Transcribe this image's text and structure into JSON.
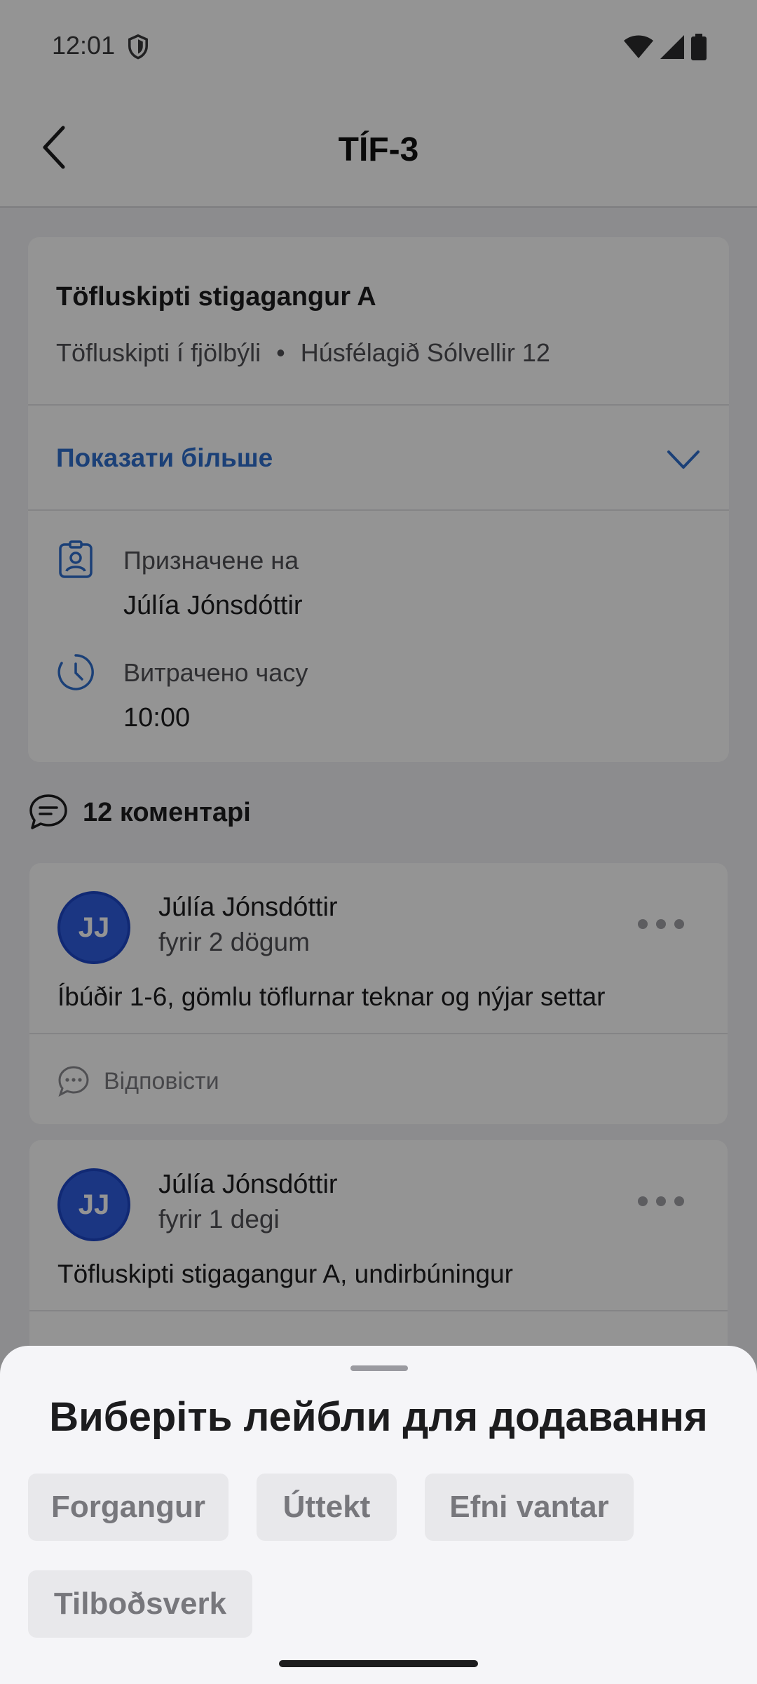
{
  "status_bar": {
    "time": "12:01"
  },
  "app_bar": {
    "title": "TÍF-3"
  },
  "task": {
    "title": "Töfluskipti stigagangur A",
    "category": "Töfluskipti í fjölbýli",
    "separator": "•",
    "association": "Húsfélagið Sólvellir 12",
    "show_more_label": "Показати більше",
    "assigned_label": "Призначене на",
    "assigned_value": "Júlía Jónsdóttir",
    "time_spent_label": "Витрачено часу",
    "time_spent_value": "10:00"
  },
  "comments": {
    "count_label": "12 коментарі",
    "items": [
      {
        "initials": "JJ",
        "author": "Júlía Jónsdóttir",
        "time": "fyrir 2 dögum",
        "body": "Íbúðir 1-6, gömlu töflurnar teknar og nýjar settar",
        "reply_label": "Відповісти"
      },
      {
        "initials": "JJ",
        "author": "Júlía Jónsdóttir",
        "time": "fyrir 1 degi",
        "body": "Töfluskipti stigagangur A, undirbúningur"
      }
    ]
  },
  "label_sheet": {
    "title": "Виберіть лейбли для додавання",
    "labels": [
      "Forgangur",
      "Úttekt",
      "Efni vantar",
      "Tilboðsverk"
    ]
  },
  "colors": {
    "accent": "#2f6fce",
    "avatar": "#2f5ee0"
  }
}
